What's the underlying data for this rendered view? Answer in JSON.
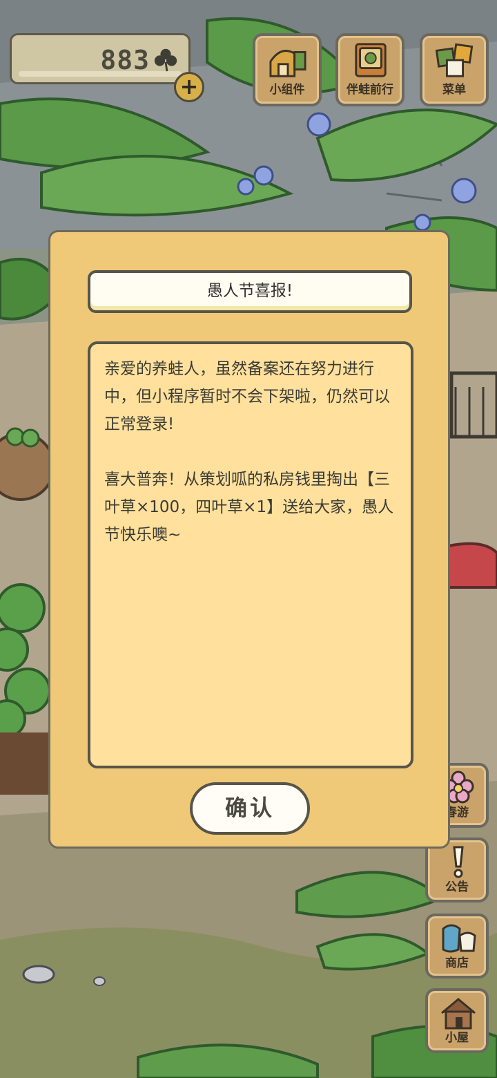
{
  "currency": {
    "value": "883"
  },
  "top_buttons": [
    {
      "label": "小组件",
      "icon": "widget-icon"
    },
    {
      "label": "伴蛙前行",
      "icon": "book-icon"
    },
    {
      "label": "菜单",
      "icon": "menu-cards-icon"
    }
  ],
  "side_buttons": [
    {
      "label": "春游",
      "icon": "flower-icon"
    },
    {
      "label": "公告",
      "icon": "exclamation-icon"
    },
    {
      "label": "商店",
      "icon": "shop-bag-icon"
    },
    {
      "label": "小屋",
      "icon": "house-icon"
    }
  ],
  "dialog": {
    "title": "愚人节喜报!",
    "body": "亲爱的养蛙人，虽然备案还在努力进行中，但小程序暂时不会下架啦，仍然可以正常登录!\n\n喜大普奔！从策划呱的私房钱里掏出【三叶草×100，四叶草×1】送给大家，愚人节快乐噢~",
    "confirm_label": "确认"
  },
  "colors": {
    "dialog_bg": "#efc977",
    "body_bg": "#ffe09c",
    "button_wood": "#c9a36a",
    "foliage": "#4f8f3f"
  }
}
